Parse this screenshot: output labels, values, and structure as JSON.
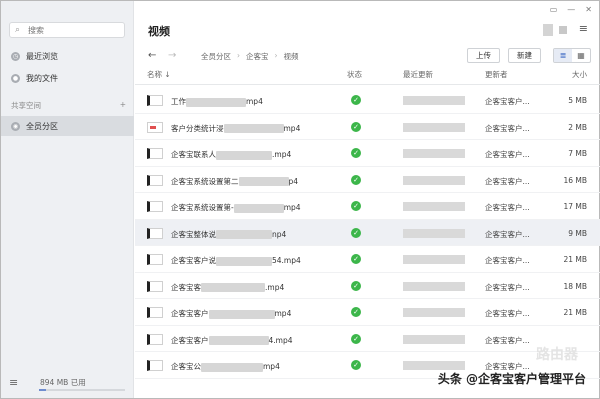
{
  "sidebar": {
    "search_placeholder": "搜索",
    "recent": "最近浏览",
    "my_files": "我的文件",
    "shared_label": "共享空间",
    "shared_add": "+",
    "all_members": "全员分区",
    "storage_used": "894 MB 已用",
    "storage_fraction": 0.08
  },
  "header": {
    "title": "视频",
    "window_controls": [
      "▭",
      "—",
      "✕"
    ],
    "menu_icon": "≡"
  },
  "toolbar": {
    "back": "←",
    "forward": "→",
    "breadcrumbs": [
      "全员分区",
      "企客宝",
      "视频"
    ],
    "upload": "上传",
    "new": "新建",
    "list_view": "≣",
    "grid_view": "▦"
  },
  "table": {
    "headers": {
      "name": "名称 ↓",
      "status": "状态",
      "modified": "最近更新",
      "updater": "更新者",
      "size": "大小"
    },
    "rows": [
      {
        "name_pre": "工作",
        "blur": 60,
        "name_post": "mp4",
        "updater": "企客宝客户...",
        "size": "5 MB",
        "icon": "video",
        "hl": false
      },
      {
        "name_pre": "客户分类统计浸",
        "blur": 60,
        "name_post": "mp4",
        "updater": "企客宝客户...",
        "size": "2 MB",
        "icon": "red",
        "hl": false
      },
      {
        "name_pre": "企客宝联系人",
        "blur": 56,
        "name_post": ".mp4",
        "updater": "企客宝客户...",
        "size": "7 MB",
        "icon": "video",
        "hl": false
      },
      {
        "name_pre": "企客宝系统设置第二",
        "blur": 50,
        "name_post": "p4",
        "updater": "企客宝客户...",
        "size": "16 MB",
        "icon": "video",
        "hl": false
      },
      {
        "name_pre": "企客宝系统设置第-",
        "blur": 50,
        "name_post": "mp4",
        "updater": "企客宝客户...",
        "size": "17 MB",
        "icon": "video",
        "hl": false
      },
      {
        "name_pre": "企客宝整体说",
        "blur": 56,
        "name_post": "np4",
        "updater": "企客宝客户...",
        "size": "9 MB",
        "icon": "video",
        "hl": true
      },
      {
        "name_pre": "企客宝客户说",
        "blur": 56,
        "name_post": "54.mp4",
        "updater": "企客宝客户...",
        "size": "21 MB",
        "icon": "file",
        "hl": false
      },
      {
        "name_pre": "企客宝客",
        "blur": 64,
        "name_post": ".mp4",
        "updater": "企客宝客户...",
        "size": "18 MB",
        "icon": "file",
        "hl": false
      },
      {
        "name_pre": "企客宝客户",
        "blur": 66,
        "name_post": "mp4",
        "updater": "企客宝客户...",
        "size": "21 MB",
        "icon": "file",
        "hl": false
      },
      {
        "name_pre": "企客宝客户",
        "blur": 60,
        "name_post": "4.mp4",
        "updater": "企客宝客户...",
        "size": "",
        "icon": "file",
        "hl": false
      },
      {
        "name_pre": "企客宝公",
        "blur": 62,
        "name_post": "mp4",
        "updater": "企客宝客户...",
        "size": "",
        "icon": "file",
        "hl": false
      }
    ]
  },
  "watermark": "头条 @企客宝客户管理平台",
  "logo": "路由器"
}
